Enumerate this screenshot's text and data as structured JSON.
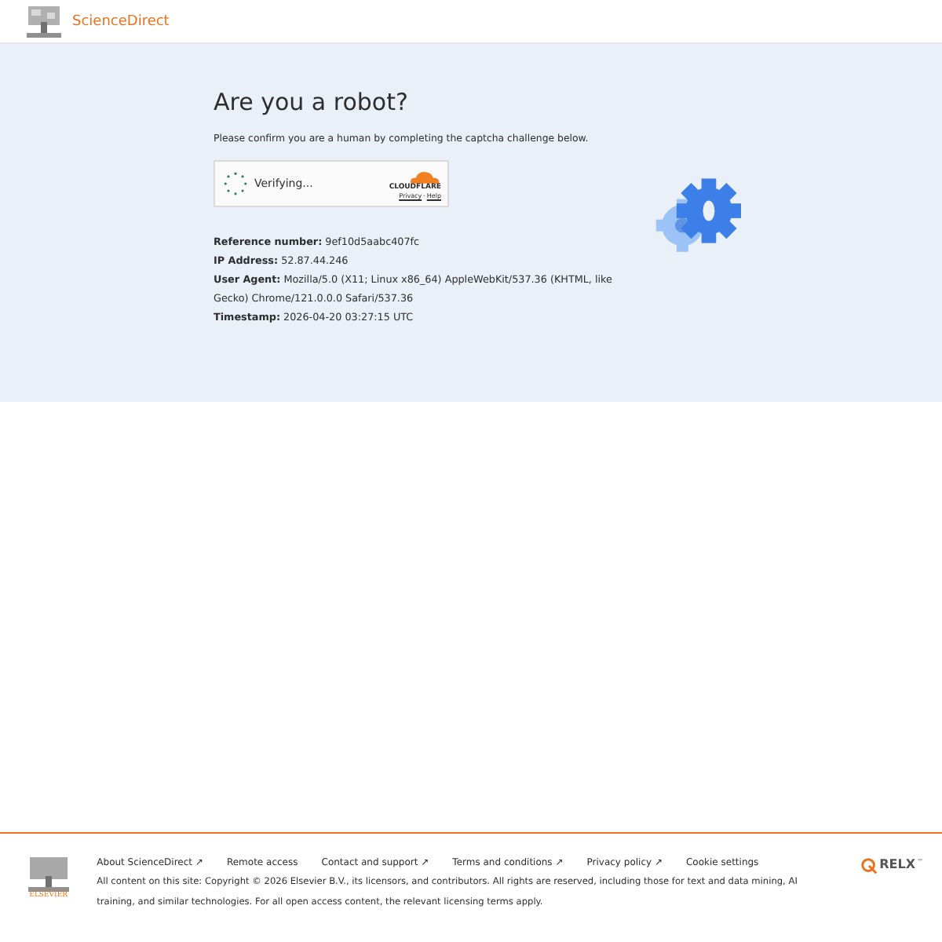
{
  "header": {
    "brand": "ScienceDirect"
  },
  "challenge": {
    "title": "Are you a robot?",
    "instruction": "Please confirm you are a human by completing the captcha challenge below.",
    "widget": {
      "status": "Verifying...",
      "provider": "CLOUDFLARE",
      "links": [
        "Privacy",
        "Help"
      ],
      "separator": "·"
    }
  },
  "details": [
    "**Reference number:** 9ef10d5aabc407fc",
    "**IP Address:** 52.87.44.246",
    "**User Agent:** Mozilla/5.0 (X11; Linux x86_64) AppleWebKit/537.36 (KHTML, like Gecko) Chrome/121.0.0.0 Safari/537.36",
    "**Timestamp:** 2026-04-20 03:27:15 UTC"
  ],
  "footer": {
    "publisher": "ELSEVIER",
    "links": [
      "About ScienceDirect ↗",
      "Remote access",
      "Contact and support ↗",
      "Terms and conditions ↗",
      "Privacy policy ↗",
      "Cookie settings"
    ],
    "copyright": "All content on this site: Copyright © 2026 Elsevier B.V., its licensors, and contributors. All rights are reserved, including those for text and data mining, AI training, and similar technologies. For all open access content, the relevant licensing terms apply.",
    "relx": "RELX",
    "tm": "™"
  }
}
